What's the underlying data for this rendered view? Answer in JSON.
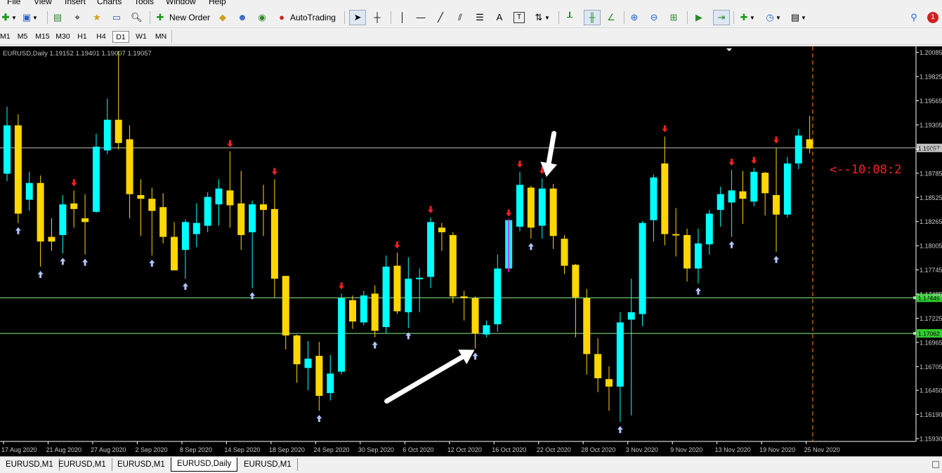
{
  "menu": [
    "File",
    "View",
    "Insert",
    "Charts",
    "Tools",
    "Window",
    "Help"
  ],
  "toolbar": {
    "new_order_label": "New Order",
    "autotrading_label": "AutoTrading",
    "text_tool_label": "A",
    "text_label_tool": "T"
  },
  "timeframes": [
    "M1",
    "M5",
    "M15",
    "M30",
    "H1",
    "H4",
    "D1",
    "W1",
    "MN"
  ],
  "active_timeframe": "D1",
  "chart": {
    "info": "EURUSD,Daily  1.19152 1.19401 1.19007 1.19057",
    "countdown": "<--10:08:2",
    "current_price_label": "1.19057",
    "hline_labels": [
      "1.17445",
      "1.17062"
    ],
    "colors": {
      "bull": "#00ffff",
      "bear": "#ffd700",
      "background": "#000000",
      "hline": "#90ee90",
      "sell_arrow": "#ff2020",
      "buy_arrow": "#b0c4ff"
    }
  },
  "chart_data": {
    "type": "candlestick",
    "symbol": "EURUSD",
    "timeframe": "Daily",
    "ylim": [
      1.159,
      1.2015
    ],
    "y_ticks": [
      "1.20085",
      "1.19825",
      "1.19565",
      "1.19305",
      "1.19045",
      "1.18785",
      "1.18525",
      "1.18265",
      "1.18005",
      "1.17745",
      "1.17485",
      "1.17225",
      "1.16965",
      "1.16705",
      "1.16450",
      "1.16190",
      "1.15930"
    ],
    "x_labels": [
      "17 Aug 2020",
      "21 Aug 2020",
      "27 Aug 2020",
      "2 Sep 2020",
      "8 Sep 2020",
      "14 Sep 2020",
      "18 Sep 2020",
      "24 Sep 2020",
      "30 Sep 2020",
      "6 Oct 2020",
      "12 Oct 2020",
      "16 Oct 2020",
      "22 Oct 2020",
      "28 Oct 2020",
      "3 Nov 2020",
      "9 Nov 2020",
      "13 Nov 2020",
      "19 Nov 2020",
      "25 Nov 2020"
    ],
    "horizontal_lines": [
      1.19057,
      1.17445,
      1.17062
    ],
    "candles": [
      [
        1.1878,
        1.193,
        1.195,
        1.187
      ],
      [
        1.193,
        1.1835,
        1.1942,
        1.1825
      ],
      [
        1.185,
        1.1868,
        1.188,
        1.1838
      ],
      [
        1.1868,
        1.1805,
        1.1876,
        1.1778
      ],
      [
        1.181,
        1.1805,
        1.183,
        1.1795
      ],
      [
        1.1812,
        1.1845,
        1.1855,
        1.1792
      ],
      [
        1.1846,
        1.184,
        1.186,
        1.182
      ],
      [
        1.183,
        1.1826,
        1.1856,
        1.1791
      ],
      [
        1.1837,
        1.1907,
        1.1921,
        1.1836
      ],
      [
        1.1903,
        1.1936,
        1.1959,
        1.1899
      ],
      [
        1.1936,
        1.1911,
        1.201,
        1.1904
      ],
      [
        1.1915,
        1.1856,
        1.193,
        1.183
      ],
      [
        1.1855,
        1.1851,
        1.1872,
        1.1811
      ],
      [
        1.1851,
        1.1838,
        1.1863,
        1.179
      ],
      [
        1.1842,
        1.181,
        1.1857,
        1.1803
      ],
      [
        1.181,
        1.1774,
        1.1826,
        1.1788
      ],
      [
        1.1796,
        1.1826,
        1.1829,
        1.1765
      ],
      [
        1.1813,
        1.1825,
        1.1846,
        1.1799
      ],
      [
        1.1822,
        1.1853,
        1.1858,
        1.1815
      ],
      [
        1.1845,
        1.1862,
        1.1872,
        1.1822
      ],
      [
        1.186,
        1.1844,
        1.1902,
        1.182
      ],
      [
        1.1846,
        1.1812,
        1.1881,
        1.1796
      ],
      [
        1.1815,
        1.1845,
        1.1849,
        1.1755
      ],
      [
        1.1845,
        1.1839,
        1.1866,
        1.1811
      ],
      [
        1.184,
        1.1765,
        1.1872,
        1.1745
      ],
      [
        1.1768,
        1.1704,
        1.1768,
        1.1689
      ],
      [
        1.1704,
        1.1673,
        1.1705,
        1.1653
      ],
      [
        1.1669,
        1.1679,
        1.1698,
        1.1645
      ],
      [
        1.1682,
        1.1639,
        1.1697,
        1.1623
      ],
      [
        1.1642,
        1.1663,
        1.1683,
        1.1634
      ],
      [
        1.1665,
        1.1744,
        1.1749,
        1.1662
      ],
      [
        1.1742,
        1.1719,
        1.1747,
        1.1711
      ],
      [
        1.1718,
        1.1747,
        1.1752,
        1.1715
      ],
      [
        1.1749,
        1.1709,
        1.1758,
        1.1702
      ],
      [
        1.1713,
        1.1778,
        1.179,
        1.1706
      ],
      [
        1.1779,
        1.173,
        1.1793,
        1.1727
      ],
      [
        1.1729,
        1.1765,
        1.1788,
        1.1712
      ],
      [
        1.1765,
        1.1766,
        1.1776,
        1.1729
      ],
      [
        1.1767,
        1.1826,
        1.1831,
        1.1755
      ],
      [
        1.182,
        1.1815,
        1.1825,
        1.1795
      ],
      [
        1.1812,
        1.1746,
        1.1815,
        1.1739
      ],
      [
        1.1746,
        1.1744,
        1.1752,
        1.172
      ],
      [
        1.1744,
        1.1706,
        1.1746,
        1.169
      ],
      [
        1.1705,
        1.1715,
        1.172,
        1.1702
      ],
      [
        1.1716,
        1.1776,
        1.1791,
        1.1708
      ],
      [
        1.1776,
        1.1828,
        1.1829,
        1.1772
      ],
      [
        1.1821,
        1.1866,
        1.188,
        1.1816
      ],
      [
        1.1863,
        1.182,
        1.1865,
        1.1808
      ],
      [
        1.1822,
        1.1862,
        1.1873,
        1.1808
      ],
      [
        1.1862,
        1.1811,
        1.1867,
        1.1797
      ],
      [
        1.1808,
        1.1779,
        1.1812,
        1.177
      ],
      [
        1.178,
        1.1745,
        1.1781,
        1.1702
      ],
      [
        1.1744,
        1.1684,
        1.1754,
        1.1662
      ],
      [
        1.1684,
        1.1658,
        1.1701,
        1.1643
      ],
      [
        1.1657,
        1.1649,
        1.1671,
        1.1623
      ],
      [
        1.1649,
        1.1718,
        1.1729,
        1.1611
      ],
      [
        1.1721,
        1.1729,
        1.1765,
        1.1618
      ],
      [
        1.1727,
        1.1825,
        1.1827,
        1.1714
      ],
      [
        1.1828,
        1.1874,
        1.1877,
        1.1805
      ],
      [
        1.1889,
        1.1813,
        1.1918,
        1.1801
      ],
      [
        1.1813,
        1.1812,
        1.1841,
        1.1789
      ],
      [
        1.1812,
        1.1776,
        1.1819,
        1.1762
      ],
      [
        1.1776,
        1.1803,
        1.1819,
        1.176
      ],
      [
        1.1802,
        1.1835,
        1.1839,
        1.1791
      ],
      [
        1.1839,
        1.1856,
        1.1864,
        1.1821
      ],
      [
        1.1847,
        1.186,
        1.1882,
        1.181
      ],
      [
        1.1859,
        1.1851,
        1.1881,
        1.1824
      ],
      [
        1.1848,
        1.188,
        1.1884,
        1.1843
      ],
      [
        1.1879,
        1.1857,
        1.188,
        1.1833
      ],
      [
        1.1855,
        1.1834,
        1.1906,
        1.1794
      ],
      [
        1.1834,
        1.1889,
        1.1896,
        1.1831
      ],
      [
        1.1889,
        1.1919,
        1.1926,
        1.1883
      ],
      [
        1.1915,
        1.1905,
        1.194,
        1.19
      ]
    ],
    "annotations": [
      {
        "type": "sell_arrow",
        "candle_index": 45
      },
      {
        "type": "white_arrow",
        "from_candle_index": 49,
        "to_candle_index": 48,
        "direction": "down"
      },
      {
        "type": "white_arrow",
        "from_candle_index": 34,
        "to_candle_index": 42,
        "direction": "up"
      }
    ]
  },
  "tabs": [
    "EURUSD,M1",
    "EURUSD,M1",
    "EURUSD,M1",
    "EURUSD,Daily",
    "EURUSD,M1"
  ],
  "active_tab": "EURUSD,Daily"
}
